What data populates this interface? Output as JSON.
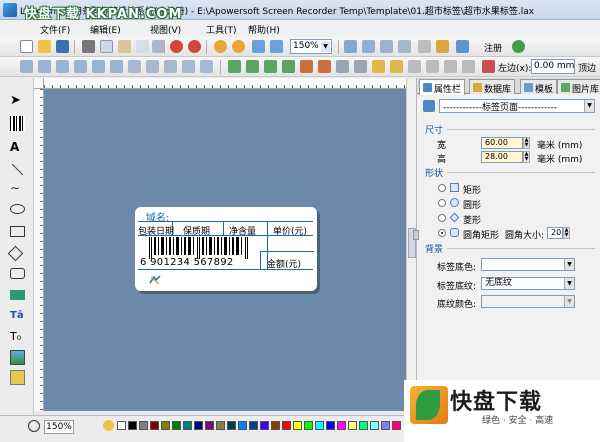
{
  "window": {
    "title": "Label mx 通用条码标签设计系统(未注册) - E:\\Apowersoft Screen Recorder Temp\\Template\\01.超市标签\\超市水果标签.lax",
    "watermark": "快盘下载 KKPAN.COM"
  },
  "menu": {
    "items": [
      "文件(F)",
      "编辑(E)",
      "视图(V)",
      "工具(T)",
      "帮助(H)"
    ]
  },
  "toolbar": {
    "zoom": "150%",
    "register_label": "注册",
    "left_label": "左边(x):",
    "left_value": "0.00 mm",
    "top_label": "顶边"
  },
  "label": {
    "domain": "域名:",
    "headers": [
      "包装日期",
      "保质期",
      "净含量",
      "单价(元)"
    ],
    "barcode_digits": "6 901234 567892",
    "price_label": "金额(元)"
  },
  "panel": {
    "tabs": [
      "属性栏",
      "数据库",
      "模板",
      "图片库"
    ],
    "object_select": "------------标签页面------------",
    "size_section": "尺寸",
    "width_label": "宽",
    "width_value": "60.00",
    "height_label": "高",
    "height_value": "28.00",
    "unit": "毫米 (mm)",
    "shape_section": "形状",
    "shapes": [
      "矩形",
      "圆形",
      "菱形",
      "圆角矩形"
    ],
    "corner_label": "圆角大小:",
    "corner_value": "20",
    "bg_section": "背景",
    "bg_color_label": "标签底色:",
    "bg_pattern_label": "标签底纹:",
    "bg_pattern_value": "无底纹",
    "pattern_color_label": "底纹颜色:"
  },
  "status": {
    "zoom": "150%"
  },
  "watermark_bottom": {
    "title": "快盘下载",
    "tagline": "绿色 · 安全 · 高速"
  },
  "colors": {
    "canvas": "#6d89a9",
    "accent": "#1b67b0"
  }
}
